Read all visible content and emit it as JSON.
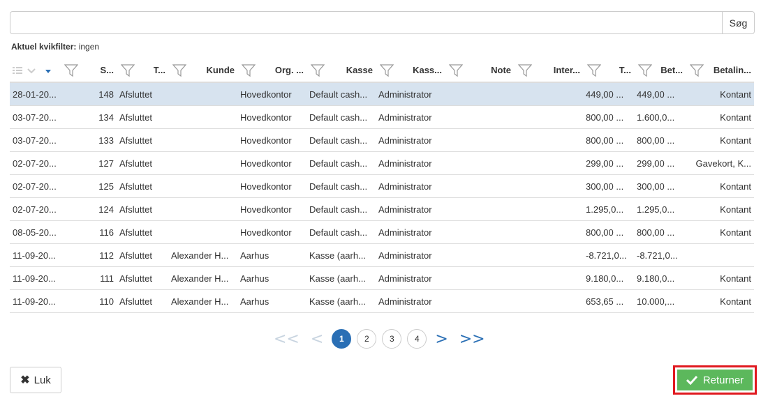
{
  "search": {
    "value": "",
    "placeholder": "",
    "button_label": "Søg"
  },
  "quickfilter": {
    "label": "Aktuel kvikfilter:",
    "value": "ingen"
  },
  "columns": [
    "S...",
    "T...",
    "Kunde",
    "Org. ...",
    "Kasse",
    "Kass...",
    "Note",
    "Inter...",
    "T...",
    "Bet...",
    "Betalin..."
  ],
  "rows": [
    {
      "date": "28-01-20...",
      "num": "148",
      "status": "Afsluttet",
      "customer": "",
      "org": "Hovedkontor",
      "register": "Default cash...",
      "cashier": "Administrator",
      "note": "",
      "internal": "",
      "total": "449,00 ...",
      "paid": "449,00 ...",
      "payment": "Kontant"
    },
    {
      "date": "03-07-20...",
      "num": "134",
      "status": "Afsluttet",
      "customer": "",
      "org": "Hovedkontor",
      "register": "Default cash...",
      "cashier": "Administrator",
      "note": "",
      "internal": "",
      "total": "800,00 ...",
      "paid": "1.600,0...",
      "payment": "Kontant"
    },
    {
      "date": "03-07-20...",
      "num": "133",
      "status": "Afsluttet",
      "customer": "",
      "org": "Hovedkontor",
      "register": "Default cash...",
      "cashier": "Administrator",
      "note": "",
      "internal": "",
      "total": "800,00 ...",
      "paid": "800,00 ...",
      "payment": "Kontant"
    },
    {
      "date": "02-07-20...",
      "num": "127",
      "status": "Afsluttet",
      "customer": "",
      "org": "Hovedkontor",
      "register": "Default cash...",
      "cashier": "Administrator",
      "note": "",
      "internal": "",
      "total": "299,00 ...",
      "paid": "299,00 ...",
      "payment": "Gavekort, K..."
    },
    {
      "date": "02-07-20...",
      "num": "125",
      "status": "Afsluttet",
      "customer": "",
      "org": "Hovedkontor",
      "register": "Default cash...",
      "cashier": "Administrator",
      "note": "",
      "internal": "",
      "total": "300,00 ...",
      "paid": "300,00 ...",
      "payment": "Kontant"
    },
    {
      "date": "02-07-20...",
      "num": "124",
      "status": "Afsluttet",
      "customer": "",
      "org": "Hovedkontor",
      "register": "Default cash...",
      "cashier": "Administrator",
      "note": "",
      "internal": "",
      "total": "1.295,0...",
      "paid": "1.295,0...",
      "payment": "Kontant"
    },
    {
      "date": "08-05-20...",
      "num": "116",
      "status": "Afsluttet",
      "customer": "",
      "org": "Hovedkontor",
      "register": "Default cash...",
      "cashier": "Administrator",
      "note": "",
      "internal": "",
      "total": "800,00 ...",
      "paid": "800,00 ...",
      "payment": "Kontant"
    },
    {
      "date": "11-09-20...",
      "num": "112",
      "status": "Afsluttet",
      "customer": "Alexander H...",
      "org": "Aarhus",
      "register": "Kasse (aarh...",
      "cashier": "Administrator",
      "note": "",
      "internal": "",
      "total": "-8.721,0...",
      "paid": "-8.721,0...",
      "payment": ""
    },
    {
      "date": "11-09-20...",
      "num": "111",
      "status": "Afsluttet",
      "customer": "Alexander H...",
      "org": "Aarhus",
      "register": "Kasse (aarh...",
      "cashier": "Administrator",
      "note": "",
      "internal": "",
      "total": "9.180,0...",
      "paid": "9.180,0...",
      "payment": "Kontant"
    },
    {
      "date": "11-09-20...",
      "num": "110",
      "status": "Afsluttet",
      "customer": "Alexander H...",
      "org": "Aarhus",
      "register": "Kasse (aarh...",
      "cashier": "Administrator",
      "note": "",
      "internal": "",
      "total": "653,65 ...",
      "paid": "10.000,...",
      "payment": "Kontant"
    }
  ],
  "pager": {
    "first": "<<",
    "prev": "<",
    "pages": [
      "1",
      "2",
      "3",
      "4"
    ],
    "current": "1",
    "next": ">",
    "last": ">>"
  },
  "footer": {
    "close_label": "Luk",
    "return_label": "Returner"
  },
  "colors": {
    "accent": "#2a6fb5",
    "selected_row": "#d7e3ef",
    "return_bg": "#5cb85c",
    "highlight_border": "#e0191f"
  }
}
